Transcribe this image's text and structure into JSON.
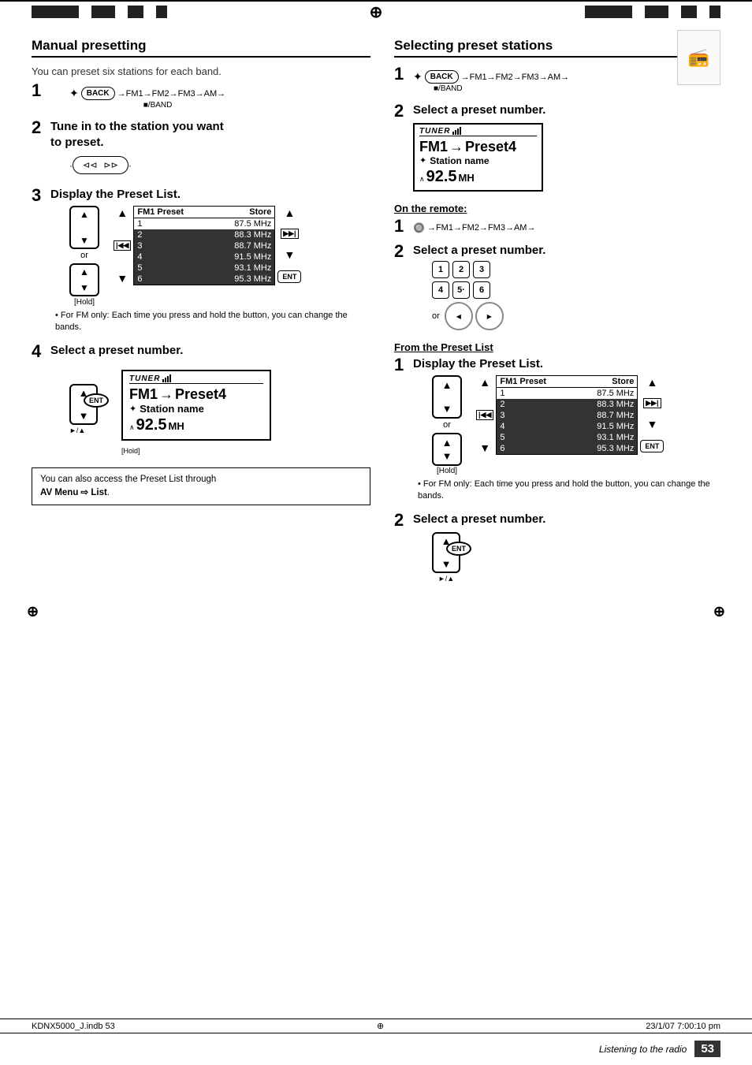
{
  "page": {
    "number": "53",
    "footer_italic": "Listening to the radio",
    "file_ref": "KDNX5000_J.indb  53",
    "date_ref": "23/1/07  7:00:10 pm",
    "crosshair": "⊕"
  },
  "left": {
    "section_title": "Manual presetting",
    "intro_text": "You can preset six stations for each band.",
    "step1": {
      "num": "1",
      "band_seq": "→FM1→FM2→FM3→AM→",
      "band_label": "■/BAND",
      "back_btn": "BACK"
    },
    "step2": {
      "num": "2",
      "heading_line1": "Tune in to the station you want",
      "heading_line2": "to preset."
    },
    "step3": {
      "num": "3",
      "heading": "Display the Preset List.",
      "or_text": "or",
      "hold_label": "[Hold]",
      "preset_header_left": "FM1 Preset",
      "preset_header_right": "Store",
      "rows": [
        {
          "num": "1",
          "freq": "87.5 MHz",
          "highlight": false
        },
        {
          "num": "2",
          "freq": "88.3 MHz",
          "highlight": true
        },
        {
          "num": "3",
          "freq": "88.7 MHz",
          "highlight": true
        },
        {
          "num": "4",
          "freq": "91.5 MHz",
          "highlight": true
        },
        {
          "num": "5",
          "freq": "93.1 MHz",
          "highlight": true
        },
        {
          "num": "6",
          "freq": "95.3 MHz",
          "highlight": true
        }
      ],
      "bullet": "For FM only: Each time you press and hold the button, you can change the bands."
    },
    "step4": {
      "num": "4",
      "heading": "Select a preset number.",
      "hold_label": "[Hold]",
      "tuner_title": "TUNER",
      "tuner_preset": "FM1",
      "tuner_arrow": "→",
      "tuner_preset_num": "Preset4",
      "tuner_station_label": "Station name",
      "tuner_freq": "92.5",
      "tuner_unit": "MH"
    },
    "note_box": {
      "text_before": "You can also access the Preset List through",
      "bold_text": "AV Menu ⇨ List",
      "text_after": "."
    }
  },
  "right": {
    "section_title": "Selecting preset stations",
    "step1": {
      "num": "1",
      "band_seq": "→FM1→FM2→FM3→AM→",
      "band_label": "■/BAND",
      "back_btn": "BACK"
    },
    "step2": {
      "num": "2",
      "heading": "Select a preset number.",
      "tuner_title": "TUNER",
      "tuner_preset": "FM1",
      "tuner_preset4": "Preset4",
      "tuner_station": "Station name",
      "tuner_freq": "92.5",
      "tuner_unit": "MH"
    },
    "on_remote": {
      "label": "On the remote:",
      "step1_num": "1",
      "step1_seq": "→FM1→FM2→FM3→AM→",
      "step2_num": "2",
      "step2_heading": "Select a preset number.",
      "num_buttons_row1": [
        "1",
        "2",
        "3"
      ],
      "num_buttons_row2": [
        "4",
        "5·",
        "6"
      ],
      "or_text": "or"
    },
    "from_preset": {
      "label": "From the Preset List",
      "step1_num": "1",
      "step1_heading": "Display the Preset List.",
      "preset_header_left": "FM1 Preset",
      "preset_header_right": "Store",
      "rows": [
        {
          "num": "1",
          "freq": "87.5 MHz",
          "highlight": false
        },
        {
          "num": "2",
          "freq": "88.3 MHz",
          "highlight": true
        },
        {
          "num": "3",
          "freq": "88.7 MHz",
          "highlight": true
        },
        {
          "num": "4",
          "freq": "91.5 MHz",
          "highlight": true
        },
        {
          "num": "5",
          "freq": "93.1 MHz",
          "highlight": true
        },
        {
          "num": "6",
          "freq": "95.3 MHz",
          "highlight": true
        }
      ],
      "or_text": "or",
      "hold_label": "[Hold]",
      "bullet": "For FM only: Each time you press and hold the button, you can change the bands.",
      "step2_num": "2",
      "step2_heading": "Select a preset number.",
      "ent_label": "ENT",
      "play_label": "►/▲"
    }
  }
}
